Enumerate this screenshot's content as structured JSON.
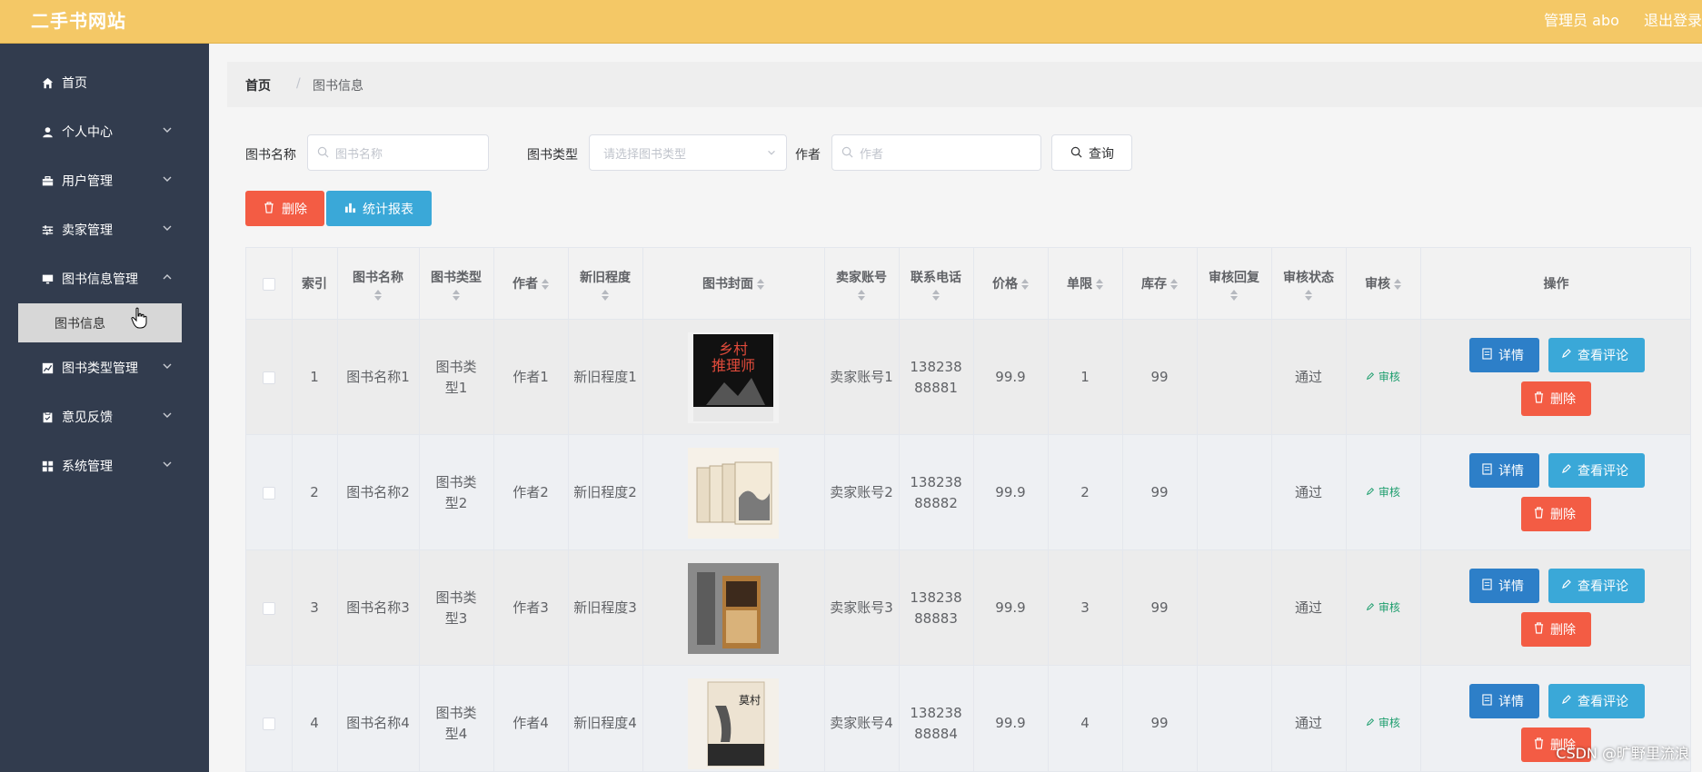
{
  "header": {
    "brand": "二手书网站",
    "admin": "管理员 abo",
    "logout": "退出登录"
  },
  "sidebar": {
    "items": [
      {
        "label": "首页",
        "icon": "home-icon"
      },
      {
        "label": "个人中心",
        "icon": "user-icon"
      },
      {
        "label": "用户管理",
        "icon": "briefcase-icon"
      },
      {
        "label": "卖家管理",
        "icon": "sliders-icon"
      },
      {
        "label": "图书信息管理",
        "icon": "monitor-icon"
      },
      {
        "label": "图书类型管理",
        "icon": "chart-icon"
      },
      {
        "label": "意见反馈",
        "icon": "clipboard-icon"
      },
      {
        "label": "系统管理",
        "icon": "grid-icon"
      }
    ],
    "active_sub": "图书信息"
  },
  "breadcrumb": {
    "home": "首页",
    "sep": "/",
    "current": "图书信息"
  },
  "search": {
    "name_label": "图书名称",
    "name_placeholder": "图书名称",
    "type_label": "图书类型",
    "type_placeholder": "请选择图书类型",
    "author_label": "作者",
    "author_placeholder": "作者",
    "query_label": "查询"
  },
  "toolbar": {
    "delete_label": "删除",
    "report_label": "统计报表"
  },
  "table": {
    "headers": [
      "索引",
      "图书名称",
      "图书类型",
      "作者",
      "新旧程度",
      "图书封面",
      "卖家账号",
      "联系电话",
      "价格",
      "单限",
      "库存",
      "审核回复",
      "审核状态",
      "审核",
      "操作"
    ],
    "rows": [
      {
        "index": "1",
        "name": "图书名称1",
        "type": "图书类型1",
        "author": "作者1",
        "condition": "新旧程度1",
        "seller": "卖家账号1",
        "phone": "13823888881",
        "price": "99.9",
        "limit": "1",
        "stock": "99",
        "reply": "",
        "status": "通过",
        "audit": "审核"
      },
      {
        "index": "2",
        "name": "图书名称2",
        "type": "图书类型2",
        "author": "作者2",
        "condition": "新旧程度2",
        "seller": "卖家账号2",
        "phone": "13823888882",
        "price": "99.9",
        "limit": "2",
        "stock": "99",
        "reply": "",
        "status": "通过",
        "audit": "审核"
      },
      {
        "index": "3",
        "name": "图书名称3",
        "type": "图书类型3",
        "author": "作者3",
        "condition": "新旧程度3",
        "seller": "卖家账号3",
        "phone": "13823888883",
        "price": "99.9",
        "limit": "3",
        "stock": "99",
        "reply": "",
        "status": "通过",
        "audit": "审核"
      },
      {
        "index": "4",
        "name": "图书名称4",
        "type": "图书类型4",
        "author": "作者4",
        "condition": "新旧程度4",
        "seller": "卖家账号4",
        "phone": "13823888884",
        "price": "99.9",
        "limit": "4",
        "stock": "99",
        "reply": "",
        "status": "通过",
        "audit": "审核"
      }
    ],
    "actions": {
      "detail": "详情",
      "comments": "查看评论",
      "delete": "删除"
    }
  },
  "watermark": "CSDN @旷野里流浪",
  "colors": {
    "header": "#f4c866",
    "sidebar": "#323c4e",
    "primary": "#2d7fc8",
    "info": "#3aa8d8",
    "danger": "#f35c44"
  }
}
